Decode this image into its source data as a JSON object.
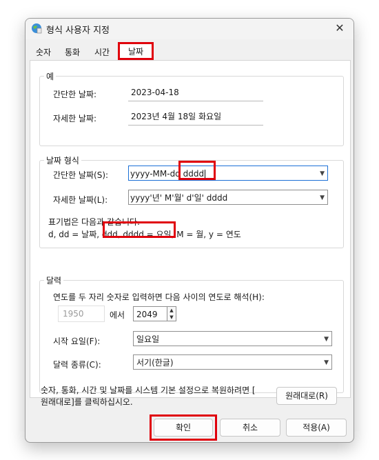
{
  "window": {
    "title": "형식 사용자 지정",
    "close_symbol": "✕"
  },
  "tabs": [
    "숫자",
    "통화",
    "시간",
    "날짜"
  ],
  "example": {
    "group_title": "예",
    "short_label": "간단한 날짜:",
    "short_value": "2023-04-18",
    "long_label": "자세한 날짜:",
    "long_value": "2023년 4월 18일 화요일"
  },
  "date_format": {
    "group_title": "날짜 형식",
    "short_label": "간단한 날짜(S):",
    "short_value_prefix": "yyyy-MM-dd",
    "short_value_suffix": " dddd",
    "long_label": "자세한 날짜(L):",
    "long_value": "yyyy'년' M'월' d'일' dddd",
    "notation_line1": "표기법은 다음과 같습니다.",
    "notation_line2_a": "d, dd = 날짜, ",
    "notation_line2_b": "ddd, dddd = 요일,",
    "notation_line2_c": " M = 월, y = 연도"
  },
  "calendar": {
    "group_title": "달력",
    "year_range_label": "연도를 두 자리 숫자로 입력하면 다음 사이의 연도로 해석(H):",
    "year_from": "1950",
    "between_word": "에서",
    "year_to": "2049",
    "first_day_label": "시작 요일(F):",
    "first_day_value": "일요일",
    "calendar_type_label": "달력 종류(C):",
    "calendar_type_value": "서기(한글)"
  },
  "restore": {
    "text_line1": "숫자, 통화, 시간 및 날짜를 시스템 기본 설정으로 복원하려면 [",
    "text_line2": "원래대로]를 클릭하십시오.",
    "button": "원래대로(R)"
  },
  "footer": {
    "ok": "확인",
    "cancel": "취소",
    "apply": "적용(A)"
  },
  "colors": {
    "highlight": "#e0000b",
    "focus_border": "#1a6fd6"
  }
}
